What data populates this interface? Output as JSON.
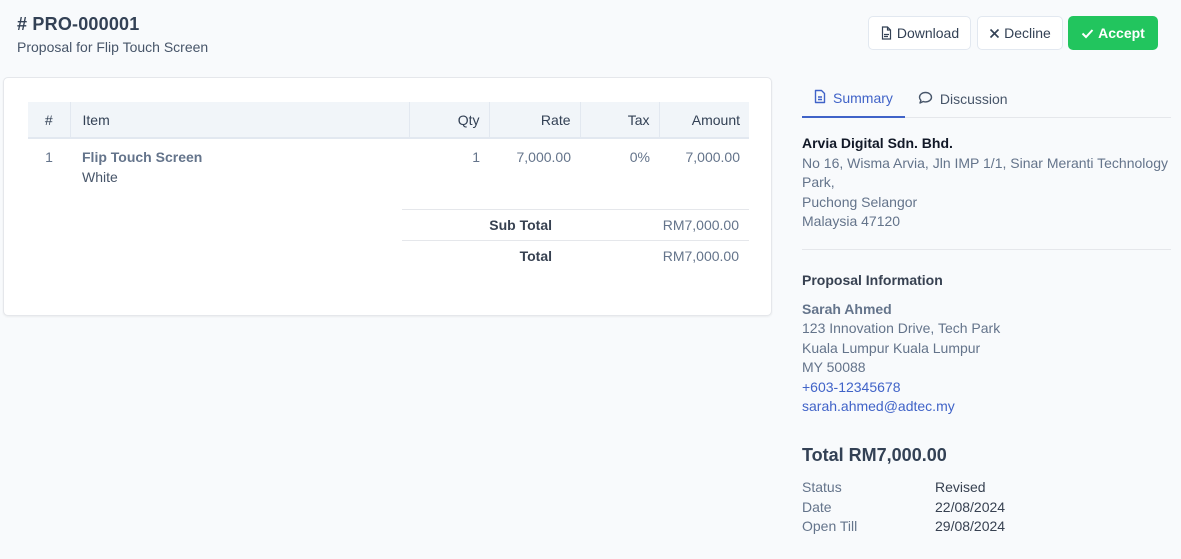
{
  "header": {
    "title": "# PRO-000001",
    "subtitle": "Proposal for Flip Touch Screen"
  },
  "actions": {
    "download_label": "Download",
    "download_icon": "pdf-file-icon",
    "decline_label": "Decline",
    "decline_icon": "x-icon",
    "accept_label": "Accept",
    "accept_icon": "check-icon",
    "accept_color": "#22c55e"
  },
  "table": {
    "columns": [
      "#",
      "Item",
      "Qty",
      "Rate",
      "Tax",
      "Amount"
    ],
    "rows": [
      {
        "num": "1",
        "item": "Flip Touch Screen",
        "description": "White",
        "qty": "1",
        "rate": "7,000.00",
        "tax": "0%",
        "amount": "7,000.00"
      }
    ]
  },
  "totals": {
    "subtotal_label": "Sub Total",
    "subtotal_value": "RM7,000.00",
    "total_label": "Total",
    "total_value": "RM7,000.00"
  },
  "tabs": [
    {
      "label": "Summary",
      "icon": "document-icon",
      "active": true
    },
    {
      "label": "Discussion",
      "icon": "chat-bubble-icon",
      "active": false
    }
  ],
  "accent_color": "#4063c8",
  "company": {
    "name": "Arvia Digital Sdn. Bhd.",
    "address_line1": "No 16, Wisma Arvia, Jln IMP 1/1, Sinar Meranti Technology Park,",
    "address_line2": "Puchong Selangor",
    "address_line3": "Malaysia 47120"
  },
  "proposal_info": {
    "title": "Proposal Information",
    "name": "Sarah Ahmed",
    "address_line1": "123 Innovation Drive, Tech Park",
    "address_line2": "Kuala Lumpur Kuala Lumpur",
    "address_line3": "MY 50088",
    "phone": "+603-12345678",
    "email": "sarah.ahmed@adtec.my"
  },
  "summary": {
    "grand_total": "Total RM7,000.00",
    "status_label": "Status",
    "status_value": "Revised",
    "date_label": "Date",
    "date_value": "22/08/2024",
    "open_till_label": "Open Till",
    "open_till_value": "29/08/2024"
  }
}
